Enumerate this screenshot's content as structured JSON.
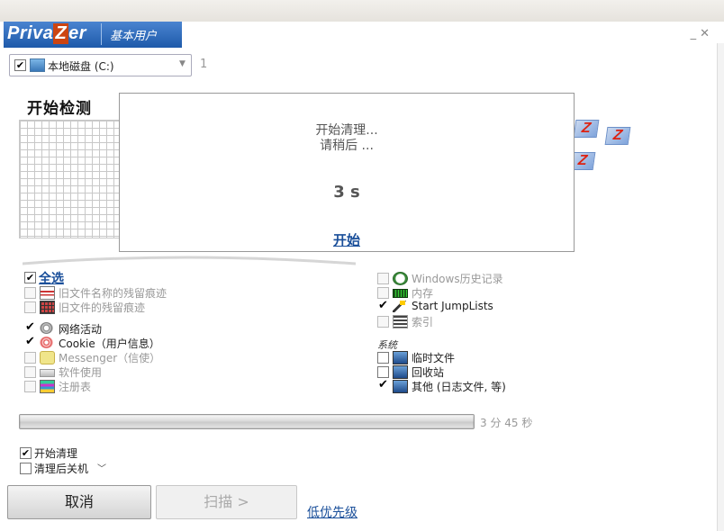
{
  "app": {
    "name_pre": "Priva",
    "name_z": "Z",
    "name_post": "er",
    "mode": "基本用户"
  },
  "window": {
    "min": "_",
    "close": "✕"
  },
  "drive": {
    "checked": true,
    "label": "本地磁盘 (C:)",
    "count": "1"
  },
  "scan": {
    "title": "开始检测"
  },
  "dialog": {
    "message1": "开始清理...",
    "message2": "请稍后 ...",
    "timer": "3 s",
    "start": "开始"
  },
  "left_list": {
    "select_all": "全选",
    "items": [
      {
        "label": "旧文件名称的残留痕迹",
        "checked": false,
        "enabled": false,
        "icon": "document-icon"
      },
      {
        "label": "旧文件的残留痕迹",
        "checked": false,
        "enabled": false,
        "icon": "grid-file-icon"
      },
      {
        "label": "网络活动",
        "checked": true,
        "enabled": true,
        "icon": "network-icon"
      },
      {
        "label": "Cookie（用户信息）",
        "checked": true,
        "enabled": true,
        "icon": "cookie-icon"
      },
      {
        "label": "Messenger（信使）",
        "checked": false,
        "enabled": false,
        "icon": "messenger-icon"
      },
      {
        "label": "软件使用",
        "checked": false,
        "enabled": false,
        "icon": "software-icon"
      },
      {
        "label": "注册表",
        "checked": false,
        "enabled": false,
        "icon": "registry-icon"
      }
    ]
  },
  "right_list": {
    "items": [
      {
        "label": "Windows历史记录",
        "checked": false,
        "enabled": false,
        "icon": "clock-icon"
      },
      {
        "label": "内存",
        "checked": false,
        "enabled": false,
        "icon": "memory-icon"
      },
      {
        "label": "Start JumpLists",
        "checked": true,
        "enabled": true,
        "icon": "wand-icon"
      },
      {
        "label": "索引",
        "checked": false,
        "enabled": false,
        "icon": "index-icon"
      }
    ],
    "system_label": "系统",
    "system_items": [
      {
        "label": "临时文件",
        "checked": false,
        "enabled": true,
        "icon": "screen-icon"
      },
      {
        "label": "回收站",
        "checked": false,
        "enabled": true,
        "icon": "screen-icon"
      },
      {
        "label": "其他 (日志文件, 等)",
        "checked": true,
        "enabled": true,
        "icon": "screen-icon"
      }
    ]
  },
  "progress": {
    "fraction": 1.0,
    "time": "3 分 45 秒"
  },
  "options": {
    "start_clean": "开始清理",
    "start_clean_checked": true,
    "shutdown": "清理后关机",
    "shutdown_checked": false
  },
  "buttons": {
    "cancel": "取消",
    "scan": "扫描 >",
    "priority": "低优先级"
  },
  "colors": {
    "brand": "#2f6cc0",
    "link": "#1a4f9a",
    "logo_accent": "#cc3311"
  }
}
